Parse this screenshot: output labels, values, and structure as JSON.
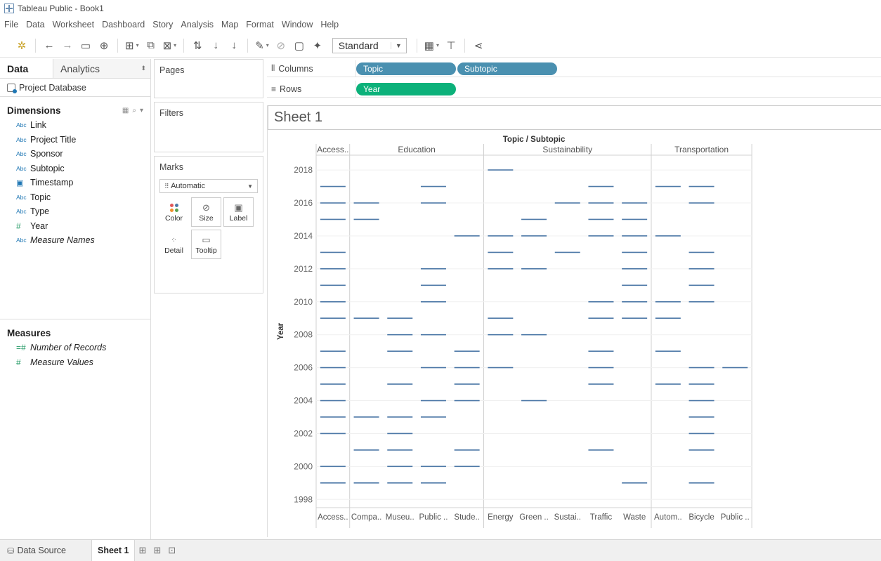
{
  "window": {
    "title": "Tableau Public - Book1"
  },
  "menu": [
    "File",
    "Data",
    "Worksheet",
    "Dashboard",
    "Story",
    "Analysis",
    "Map",
    "Format",
    "Window",
    "Help"
  ],
  "toolbar": {
    "fit_select": "Standard"
  },
  "data_pane": {
    "tab_data": "Data",
    "tab_analytics": "Analytics",
    "datasource": "Project Database",
    "dimensions_title": "Dimensions",
    "dimensions": [
      {
        "type": "Abc",
        "name": "Link"
      },
      {
        "type": "Abc",
        "name": "Project Title"
      },
      {
        "type": "Abc",
        "name": "Sponsor"
      },
      {
        "type": "Abc",
        "name": "Subtopic"
      },
      {
        "type": "cal",
        "name": "Timestamp"
      },
      {
        "type": "Abc",
        "name": "Topic"
      },
      {
        "type": "Abc",
        "name": "Type"
      },
      {
        "type": "#",
        "name": "Year"
      },
      {
        "type": "Abc",
        "name": "Measure Names"
      }
    ],
    "measures_title": "Measures",
    "measures": [
      {
        "type": "=#",
        "name": "Number of Records"
      },
      {
        "type": "#",
        "name": "Measure Values"
      }
    ]
  },
  "cards": {
    "pages": "Pages",
    "filters": "Filters",
    "marks": "Marks",
    "marks_type": "Automatic",
    "mark_buttons": [
      "Color",
      "Size",
      "Label",
      "Detail",
      "Tooltip"
    ]
  },
  "shelves": {
    "columns_label": "Columns",
    "rows_label": "Rows",
    "columns_pills": [
      "Topic",
      "Subtopic"
    ],
    "rows_pills": [
      "Year"
    ]
  },
  "sheet": {
    "title": "Sheet 1"
  },
  "chart_data": {
    "type": "scatter",
    "header_title": "Topic / Subtopic",
    "ylabel": "Year",
    "ylim": [
      1997.5,
      2018.9
    ],
    "yticks": [
      1998,
      2000,
      2002,
      2004,
      2006,
      2008,
      2010,
      2012,
      2014,
      2016,
      2018
    ],
    "topics": [
      {
        "label": "Access..",
        "subtopics": [
          "Access.."
        ]
      },
      {
        "label": "Education",
        "subtopics": [
          "Compa..",
          "Museu..",
          "Public ..",
          "Stude.."
        ]
      },
      {
        "label": "Sustainability",
        "subtopics": [
          "Energy",
          "Green ..",
          "Sustai..",
          "Traffic",
          "Waste"
        ]
      },
      {
        "label": "Transportation",
        "subtopics": [
          "Autom..",
          "Bicycle",
          "Public .."
        ]
      }
    ],
    "marks": [
      {
        "subtopic": "Access..",
        "years": [
          2017,
          2016,
          2015,
          2013,
          2012,
          2011,
          2010,
          2009,
          2007,
          2006,
          2005,
          2004,
          2003,
          2002,
          2000,
          1999
        ]
      },
      {
        "subtopic": "Compa..",
        "years": [
          2016,
          2015,
          2009,
          2003,
          2001,
          1999
        ]
      },
      {
        "subtopic": "Museu..",
        "years": [
          2009,
          2008,
          2007,
          2005,
          2003,
          2002,
          2001,
          2000,
          1999
        ]
      },
      {
        "subtopic": "Public ..",
        "years": [
          2017,
          2016,
          2012,
          2011,
          2010,
          2008,
          2006,
          2004,
          2003,
          2000,
          1999
        ]
      },
      {
        "subtopic": "Stude..",
        "years": [
          2014,
          2007,
          2006,
          2005,
          2004,
          2001,
          2000
        ]
      },
      {
        "subtopic": "Energy",
        "years": [
          2018,
          2014,
          2013,
          2012,
          2009,
          2008,
          2006
        ]
      },
      {
        "subtopic": "Green ..",
        "years": [
          2015,
          2014,
          2012,
          2008,
          2004
        ]
      },
      {
        "subtopic": "Sustai..",
        "years": [
          2016,
          2013
        ]
      },
      {
        "subtopic": "Traffic",
        "years": [
          2017,
          2016,
          2015,
          2014,
          2010,
          2009,
          2007,
          2006,
          2005,
          2001
        ]
      },
      {
        "subtopic": "Waste",
        "years": [
          2016,
          2015,
          2014,
          2013,
          2012,
          2011,
          2010,
          2009,
          1999
        ]
      },
      {
        "subtopic": "Autom..",
        "years": [
          2017,
          2014,
          2010,
          2009,
          2007,
          2005
        ]
      },
      {
        "subtopic": "Bicycle",
        "years": [
          2017,
          2016,
          2013,
          2012,
          2011,
          2010,
          2006,
          2005,
          2004,
          2003,
          2002,
          2001,
          1999
        ]
      },
      {
        "subtopic": "Public ..",
        "years": [
          2006
        ]
      }
    ],
    "mark_color": "#4e79a7"
  },
  "bottom": {
    "data_source": "Data Source",
    "sheet_tab": "Sheet 1"
  }
}
